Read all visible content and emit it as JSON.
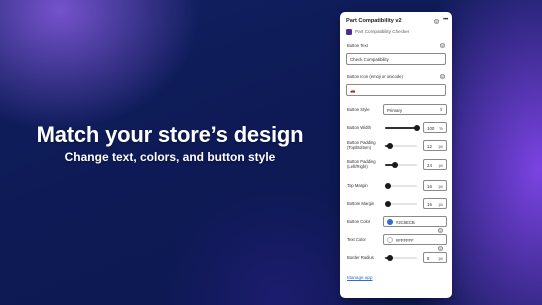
{
  "hero": {
    "title": "Match your store’s design",
    "subtitle": "Change text, colors, and button style"
  },
  "panel": {
    "title": "Part Compatibility v2",
    "app_name": "Part Compatibility Checker",
    "button_text": {
      "label": "Button Text",
      "value": "Check Compatibility"
    },
    "button_icon": {
      "label": "Button Icon (emoji or unicode)",
      "value": "🚗"
    },
    "button_style": {
      "label": "Button Style",
      "value": "Primary"
    },
    "button_width": {
      "label": "Button Width",
      "value": "100",
      "unit": "%",
      "level": 1.0
    },
    "button_padding_tb": {
      "label_line1": "Button Padding",
      "label_line2": "(Top/Bottom)",
      "value": "12",
      "unit": "px",
      "level": 0.15
    },
    "button_padding_lr": {
      "label_line1": "Button Padding",
      "label_line2": "(Left/Right)",
      "value": "24",
      "unit": "px",
      "level": 0.3
    },
    "top_margin": {
      "label": "Top Margin",
      "value": "16",
      "unit": "px",
      "level": 0.1
    },
    "bottom_margin": {
      "label": "Bottom Margin",
      "value": "16",
      "unit": "px",
      "level": 0.1
    },
    "button_color": {
      "label": "Button Color",
      "value": "#2C6ECB",
      "swatch": "#2C6ECB"
    },
    "text_color": {
      "label": "Text Color",
      "value": "#FFFFFF",
      "swatch": "#FFFFFF"
    },
    "border_radius": {
      "label": "Border Radius",
      "value": "8",
      "unit": "px",
      "level": 0.15
    },
    "manage_link": "Manage app"
  },
  "icons": {
    "database": "database-icon",
    "more": "more-horizontal-icon",
    "chevron": "chevron-updown-icon"
  },
  "colors": {
    "accent": "#2C6ECB",
    "app_icon": "#4B2C92"
  }
}
